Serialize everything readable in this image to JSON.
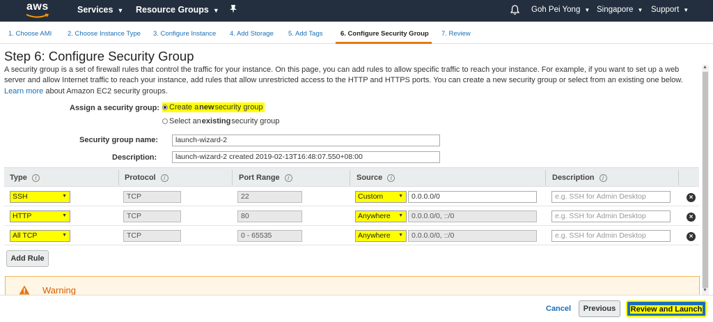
{
  "topnav": {
    "logo_text": "aws",
    "services": "Services",
    "resource_groups": "Resource Groups",
    "user": "Goh Pei Yong",
    "region": "Singapore",
    "support": "Support"
  },
  "steps": [
    {
      "label": "1. Choose AMI"
    },
    {
      "label": "2. Choose Instance Type"
    },
    {
      "label": "3. Configure Instance"
    },
    {
      "label": "4. Add Storage"
    },
    {
      "label": "5. Add Tags"
    },
    {
      "label": "6. Configure Security Group",
      "active": true
    },
    {
      "label": "7. Review"
    }
  ],
  "page": {
    "title": "Step 6: Configure Security Group",
    "intro": "A security group is a set of firewall rules that control the traffic for your instance. On this page, you can add rules to allow specific traffic to reach your instance. For example, if you want to set up a web server and allow Internet traffic to reach your instance, add rules that allow unrestricted access to the HTTP and HTTPS ports. You can create a new security group or select from an existing one below.",
    "learn_more": "Learn more",
    "intro_tail": "about Amazon EC2 security groups."
  },
  "assign": {
    "label": "Assign a security group:",
    "option_new_pre": "Create a ",
    "option_new_bold": "new",
    "option_new_post": " security group",
    "option_existing_pre": "Select an ",
    "option_existing_bold": "existing",
    "option_existing_post": " security group",
    "selected": "new"
  },
  "group": {
    "name_label": "Security group name:",
    "name_value": "launch-wizard-2",
    "desc_label": "Description:",
    "desc_value": "launch-wizard-2 created 2019-02-13T16:48:07.550+08:00"
  },
  "table": {
    "headers": {
      "type": "Type",
      "protocol": "Protocol",
      "port_range": "Port Range",
      "source": "Source",
      "description": "Description"
    },
    "rows": [
      {
        "type": "SSH",
        "protocol": "TCP",
        "port": "22",
        "source": "Custom",
        "cidr": "0.0.0.0/0",
        "desc_placeholder": "e.g. SSH for Admin Desktop"
      },
      {
        "type": "HTTP",
        "protocol": "TCP",
        "port": "80",
        "source": "Anywhere",
        "cidr": "0.0.0.0/0, ::/0",
        "desc_placeholder": "e.g. SSH for Admin Desktop"
      },
      {
        "type": "All TCP",
        "protocol": "TCP",
        "port": "0 - 65535",
        "source": "Anywhere",
        "cidr": "0.0.0.0/0, ::/0",
        "desc_placeholder": "e.g. SSH for Admin Desktop"
      }
    ]
  },
  "buttons": {
    "add_rule": "Add Rule",
    "cancel": "Cancel",
    "previous": "Previous",
    "review_launch": "Review and Launch"
  },
  "warning": {
    "title": "Warning"
  },
  "colors": {
    "nav_bg": "#232f3e",
    "accent": "#e47911",
    "link": "#1a6fb6",
    "highlight": "#ffff00",
    "primary_button": "#1b6fb5"
  }
}
